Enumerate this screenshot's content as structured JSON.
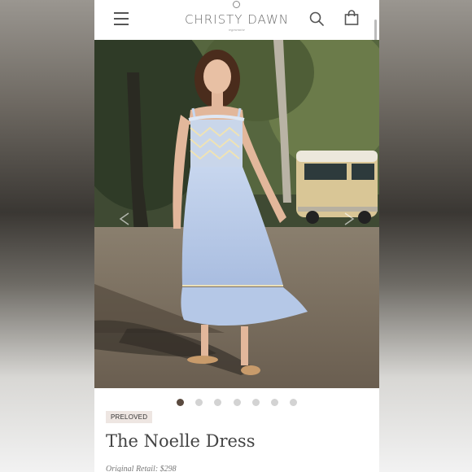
{
  "header": {
    "brand": "CHRISTY DAWN",
    "brand_sub": "regenerative",
    "icons": {
      "menu": "hamburger-menu-icon",
      "logo": "swirl-logo-icon",
      "search": "search-icon",
      "bag": "shopping-bag-icon"
    }
  },
  "gallery": {
    "image_count": 7,
    "active_index": 0,
    "icons": {
      "prev": "chevron-left-icon",
      "next": "chevron-right-icon"
    }
  },
  "product": {
    "badge": "PRELOVED",
    "title": "The Noelle Dress",
    "retail": "Original Retail: $298"
  },
  "colors": {
    "dot_active": "#5a4a3f",
    "dot_inactive": "#d3d3d3",
    "badge_bg": "#eee6e2",
    "dress": "#b9cbe6"
  }
}
